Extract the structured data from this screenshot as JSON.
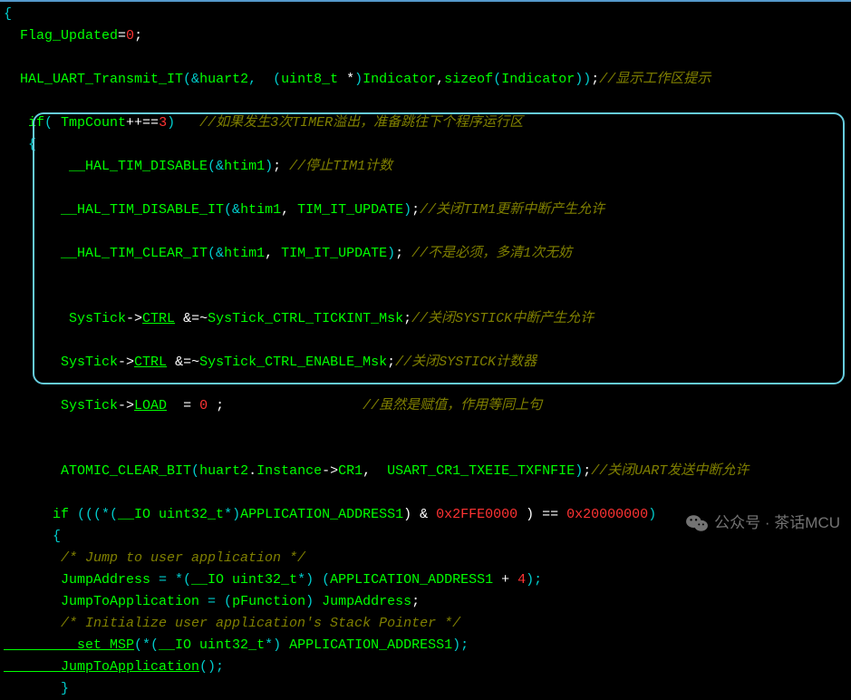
{
  "code": {
    "l01": "{",
    "l02_a": "  Flag_Updated",
    "l02_b": "=",
    "l02_c": "0",
    "l02_d": ";",
    "l03": "",
    "l04_a": "  HAL_UART_Transmit_IT",
    "l04_b": "(&",
    "l04_c": "huart2",
    "l04_d": ",  (",
    "l04_e": "uint8_t ",
    "l04_f": "*",
    "l04_g": ")",
    "l04_h": "Indicator",
    "l04_i": ",",
    "l04_j": "sizeof",
    "l04_k": "(",
    "l04_l": "Indicator",
    "l04_m": "))",
    "l04_n": ";",
    "l04_o": "//显示工作区提示",
    "l05": "",
    "l06_a": "   if",
    "l06_b": "( ",
    "l06_c": "TmpCount",
    "l06_d": "++==",
    "l06_e": "3",
    "l06_f": ")",
    "l06_g": "   //如果发生3次TIMER溢出，准备跳往下个程序运行区",
    "l07": "   {",
    "l08_a": "        __HAL_TIM_DISABLE",
    "l08_b": "(&",
    "l08_c": "htim1",
    "l08_d": ")",
    "l08_e": "; ",
    "l08_f": "//停止TIM1计数",
    "l09": "",
    "l10_a": "       __HAL_TIM_DISABLE_IT",
    "l10_b": "(&",
    "l10_c": "htim1",
    "l10_d": ", ",
    "l10_e": "TIM_IT_UPDATE",
    "l10_f": ")",
    "l10_g": ";",
    "l10_h": "//关闭TIM1更新中断产生允许",
    "l11": "",
    "l12_a": "       __HAL_TIM_CLEAR_IT",
    "l12_b": "(&",
    "l12_c": "htim1",
    "l12_d": ", ",
    "l12_e": "TIM_IT_UPDATE",
    "l12_f": ")",
    "l12_g": "; ",
    "l12_h": "//不是必须，多清1次无妨",
    "l13": "",
    "l14": "",
    "l15_a": "        SysTick",
    "l15_b": "->",
    "l15_c": "CTRL",
    "l15_d": " &=~",
    "l15_e": "SysTick_CTRL_TICKINT_Msk",
    "l15_f": ";",
    "l15_g": "//关闭SYSTICK中断产生允许",
    "l16": "",
    "l17_a": "       SysTick",
    "l17_b": "->",
    "l17_c": "CTRL",
    "l17_d": " &=~",
    "l17_e": "SysTick_CTRL_ENABLE_Msk",
    "l17_f": ";",
    "l17_g": "//关闭SYSTICK计数器",
    "l18": "",
    "l19_a": "       SysTick",
    "l19_b": "->",
    "l19_c": "LOAD",
    "l19_d": "  = ",
    "l19_e": "0",
    "l19_f": " ;                 ",
    "l19_g": "//虽然是赋值，作用等同上句",
    "l20": "",
    "l21": "       ",
    "l22_a": "       ATOMIC_CLEAR_BIT",
    "l22_b": "(",
    "l22_c": "huart2",
    "l22_d": ".",
    "l22_e": "Instance",
    "l22_f": "->",
    "l22_g": "CR1",
    "l22_h": ",  ",
    "l22_i": "USART_CR1_TXEIE_TXFNFIE",
    "l22_j": ")",
    "l22_k": ";",
    "l22_l": "//关闭UART发送中断允许",
    "l23": "",
    "l24_a": "      if ",
    "l24_b": "(((*(",
    "l24_c": "__IO uint32_t",
    "l24_d": "*)",
    "l24_e": "APPLICATION_ADDRESS1",
    "l24_f": ") & ",
    "l24_g": "0x2FFE0000 ",
    "l24_h": ") == ",
    "l24_i": "0x20000000",
    "l24_j": ")",
    "l25": "      {",
    "l26": "       /* Jump to user application */",
    "l27_a": "       JumpAddress ",
    "l27_b": "= *(",
    "l27_c": "__IO uint32_t",
    "l27_d": "*) (",
    "l27_e": "APPLICATION_ADDRESS1 ",
    "l27_f": "+ ",
    "l27_g": "4",
    "l27_h": ");",
    "l28_a": "       JumpToApplication ",
    "l28_b": "= (",
    "l28_c": "pFunction",
    "l28_d": ") ",
    "l28_e": "JumpAddress",
    "l28_f": ";",
    "l29": "       /* Initialize user application's Stack Pointer */",
    "l30_a": "       __set_MSP",
    "l30_b": "(*(",
    "l30_c": "__IO uint32_t",
    "l30_d": "*) ",
    "l30_e": "APPLICATION_ADDRESS1",
    "l30_f": ");",
    "l31_a": "       JumpToApplication",
    "l31_b": "();",
    "l32": "       }"
  },
  "watermark": {
    "text": "公众号 · 茶话MCU"
  }
}
